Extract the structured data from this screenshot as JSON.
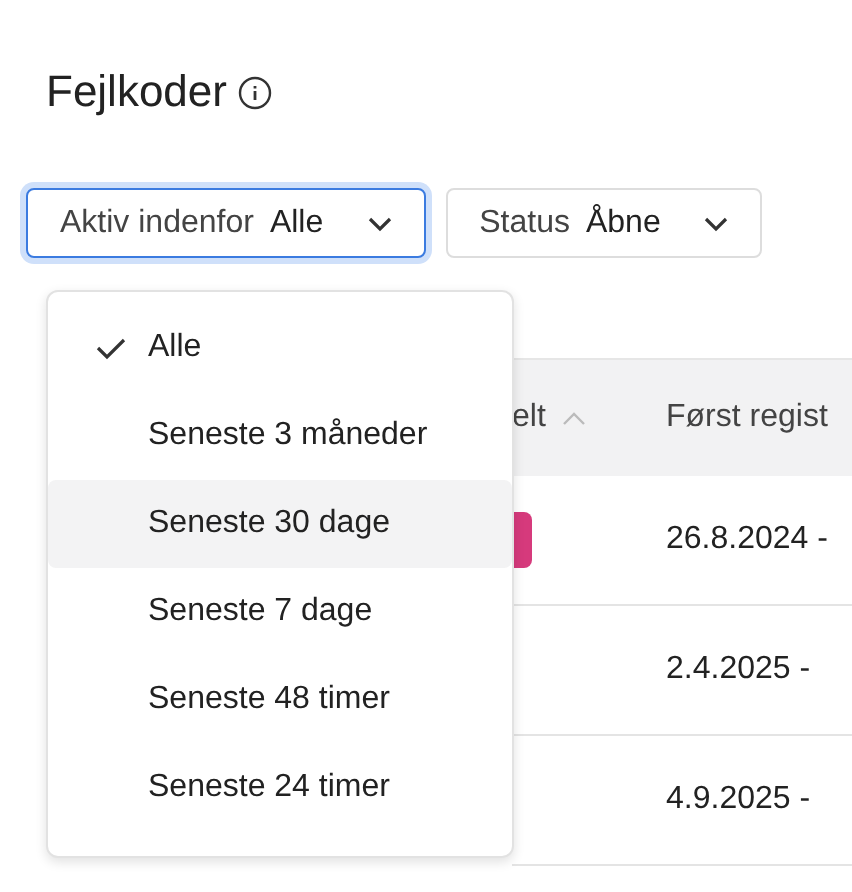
{
  "title": "Fejlkoder",
  "filters": [
    {
      "label": "Aktiv indenfor",
      "value": "Alle",
      "focused": true
    },
    {
      "label": "Status",
      "value": "Åbne",
      "focused": false
    }
  ],
  "dropdown": {
    "items": [
      {
        "label": "Alle",
        "selected": true,
        "hovered": false
      },
      {
        "label": "Seneste 3 måneder",
        "selected": false,
        "hovered": false
      },
      {
        "label": "Seneste 30 dage",
        "selected": false,
        "hovered": true
      },
      {
        "label": "Seneste 7 dage",
        "selected": false,
        "hovered": false
      },
      {
        "label": "Seneste 48 timer",
        "selected": false,
        "hovered": false
      },
      {
        "label": "Seneste 24 timer",
        "selected": false,
        "hovered": false
      }
    ]
  },
  "table": {
    "columns": [
      {
        "label": "elt",
        "sorted": true
      },
      {
        "label": "Først regist",
        "sorted": false
      }
    ],
    "rows": [
      {
        "badge": true,
        "first_registered": "26.8.2024 -"
      },
      {
        "badge": false,
        "first_registered": "2.4.2025 -"
      },
      {
        "badge": false,
        "first_registered": "4.9.2025 -"
      }
    ]
  }
}
